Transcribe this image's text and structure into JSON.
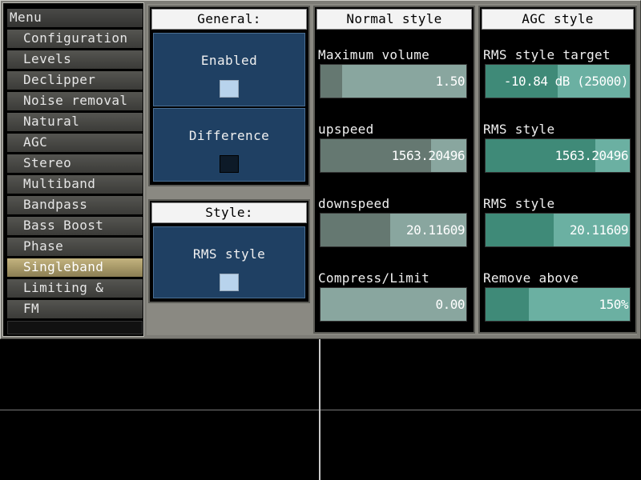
{
  "menu": {
    "header": "Menu",
    "items": [
      {
        "label": "Configuration",
        "active": false
      },
      {
        "label": "Levels",
        "active": false
      },
      {
        "label": "Declipper",
        "active": false
      },
      {
        "label": "Noise removal",
        "active": false
      },
      {
        "label": "Natural",
        "active": false
      },
      {
        "label": "AGC",
        "active": false
      },
      {
        "label": "Stereo",
        "active": false
      },
      {
        "label": "Multiband",
        "active": false
      },
      {
        "label": "Bandpass",
        "active": false
      },
      {
        "label": "Bass Boost",
        "active": false
      },
      {
        "label": "Phase",
        "active": false
      },
      {
        "label": "Singleband",
        "active": true
      },
      {
        "label": "Limiting &",
        "active": false
      },
      {
        "label": "FM",
        "active": false
      }
    ]
  },
  "general": {
    "title": "General:",
    "enabled": {
      "label": "Enabled",
      "checked": true
    },
    "difference": {
      "label": "Difference",
      "checked": false
    }
  },
  "style": {
    "title": "Style:",
    "rms": {
      "label": "RMS style",
      "checked": true
    }
  },
  "normal_style": {
    "title": "Normal style",
    "params": [
      {
        "label": "Maximum volume",
        "value": "1.50",
        "fill": 0.15
      },
      {
        "label": "upspeed",
        "value": "1563.20496",
        "fill": 0.76
      },
      {
        "label": "downspeed",
        "value": "20.11609",
        "fill": 0.48
      },
      {
        "label": "Compress/Limit",
        "value": "0.00",
        "fill": 0.0
      }
    ]
  },
  "agc_style": {
    "title": "AGC style",
    "params": [
      {
        "label": "RMS style target",
        "value": "-10.84 dB (25000)",
        "fill": 0.5
      },
      {
        "label": "RMS style",
        "value": "1563.20496",
        "fill": 0.76
      },
      {
        "label": "RMS style",
        "value": "20.11609",
        "fill": 0.47
      },
      {
        "label": "Remove above",
        "value": "150%",
        "fill": 0.3
      }
    ]
  },
  "colors": {
    "menu_active": "#c3b37e",
    "toggle_bg": "#1f4063",
    "checkbox_on": "#b8d3ec",
    "normal_slider": "#89a69f",
    "agc_slider": "#6bb0a2"
  }
}
